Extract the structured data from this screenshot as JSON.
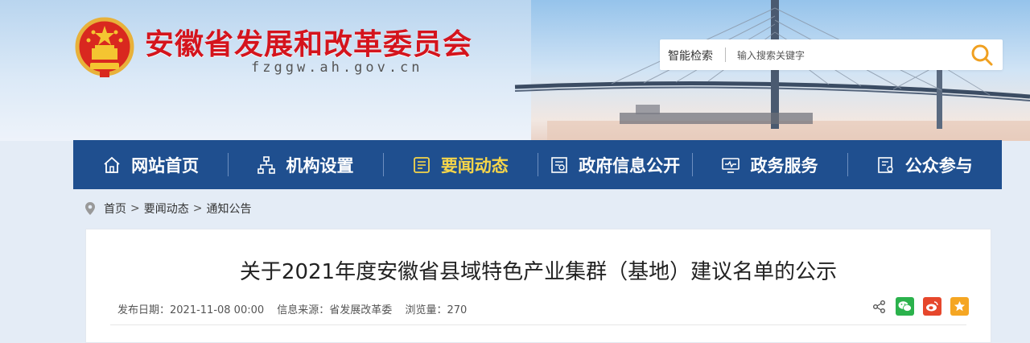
{
  "header": {
    "title": "安徽省发展和改革委员会",
    "domain": "fzggw.ah.gov.cn"
  },
  "search": {
    "label": "智能检索",
    "placeholder": "输入搜索关键字"
  },
  "nav": {
    "items": [
      {
        "label": "网站首页",
        "icon": "home-icon"
      },
      {
        "label": "机构设置",
        "icon": "org-chart-icon"
      },
      {
        "label": "要闻动态",
        "icon": "news-icon",
        "active": true
      },
      {
        "label": "政府信息公开",
        "icon": "info-disclosure-icon"
      },
      {
        "label": "政务服务",
        "icon": "monitor-icon"
      },
      {
        "label": "公众参与",
        "icon": "participation-icon"
      }
    ]
  },
  "breadcrumb": [
    "首页",
    "要闻动态",
    "通知公告"
  ],
  "article": {
    "title": "关于2021年度安徽省县域特色产业集群（基地）建议名单的公示",
    "date": "发布日期：2021-11-08 00:00",
    "source": "信息来源：省发展改革委",
    "views": "浏览量：270"
  },
  "colors": {
    "nav_bg": "#1f4f8f",
    "title_red": "#d4141d",
    "active_nav": "#f5d54a",
    "wechat": "#2bb24c",
    "weibo": "#e6472c",
    "favorite": "#f5a623"
  }
}
